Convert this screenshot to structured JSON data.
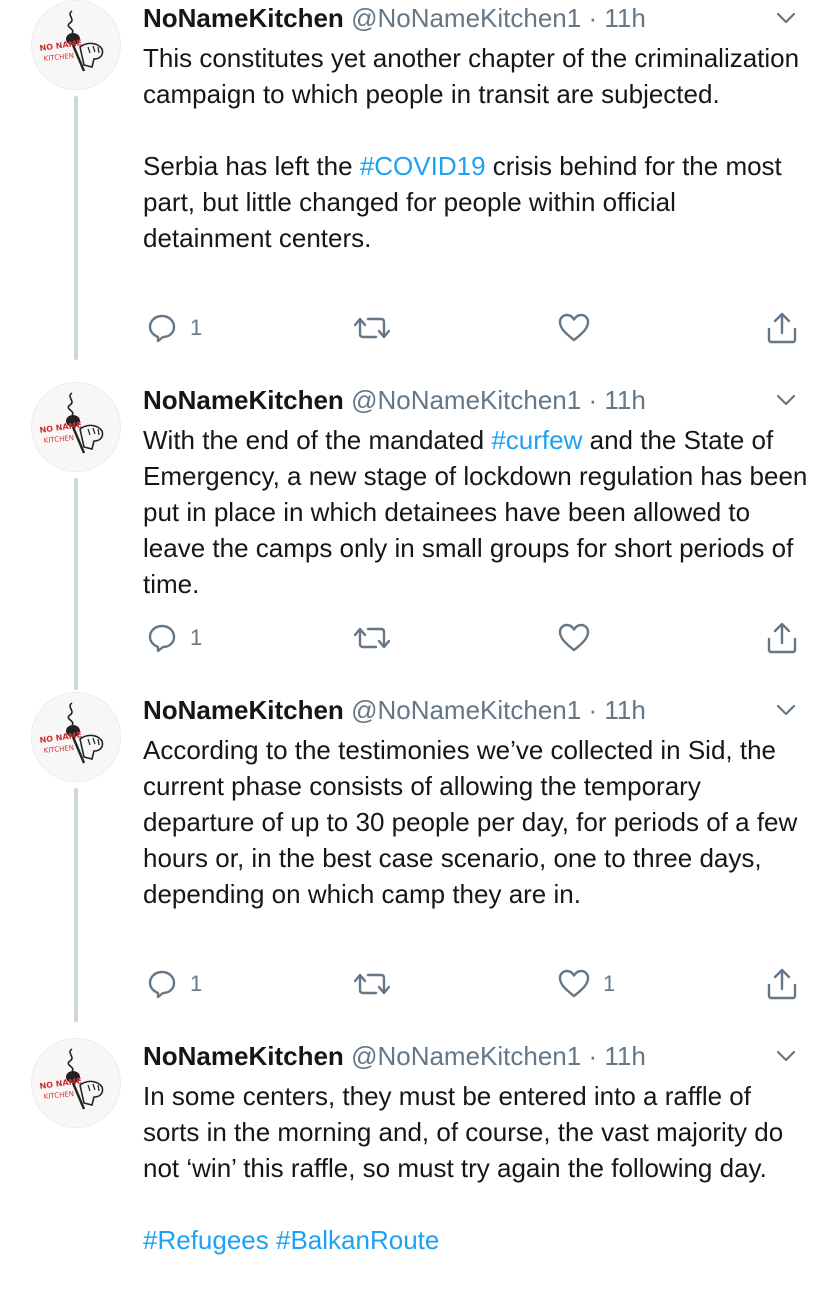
{
  "tweets": [
    {
      "name": "NoNameKitchen",
      "handle": "@NoNameKitchen1",
      "separator": "·",
      "time": "11h",
      "paragraphs": [
        [
          {
            "text": "This constitutes yet another chapter of the criminalization campaign to which people in transit are subjected."
          }
        ],
        [
          {
            "text": "Serbia has left the "
          },
          {
            "text": "#COVID19",
            "hashtag": true
          },
          {
            "text": " crisis behind for the most part, but little changed for people within official detainment centers."
          }
        ]
      ],
      "reply_count": "1",
      "like_count": ""
    },
    {
      "name": "NoNameKitchen",
      "handle": "@NoNameKitchen1",
      "separator": "·",
      "time": "11h",
      "paragraphs": [
        [
          {
            "text": "With the end of the mandated "
          },
          {
            "text": "#curfew",
            "hashtag": true
          },
          {
            "text": " and the State of Emergency, a new stage of lockdown regulation has been put in place in which detainees have been allowed to leave the camps only in small groups for short periods of time."
          }
        ]
      ],
      "reply_count": "1",
      "like_count": ""
    },
    {
      "name": "NoNameKitchen",
      "handle": "@NoNameKitchen1",
      "separator": "·",
      "time": "11h",
      "paragraphs": [
        [
          {
            "text": "According to the testimonies we’ve collected in Sid, the current phase consists of allowing the temporary departure of up to 30 people per day, for periods of a few hours or, in the best case scenario, one to three days, depending on which camp they are in."
          }
        ]
      ],
      "reply_count": "1",
      "like_count": "1"
    },
    {
      "name": "NoNameKitchen",
      "handle": "@NoNameKitchen1",
      "separator": "·",
      "time": "11h",
      "paragraphs": [
        [
          {
            "text": "In some centers, they must be entered into a raffle of sorts in the morning and, of course, the vast majority do not ‘win’ this raffle, so must try again the following day."
          }
        ],
        [
          {
            "text": "#Refugees",
            "hashtag": true
          },
          {
            "text": " "
          },
          {
            "text": "#BalkanRoute",
            "hashtag": true
          }
        ]
      ]
    }
  ],
  "avatar_logo": {
    "name": "NoNameKitchen logo",
    "text_line1": "NO NAME",
    "text_line2": "KITCHEN"
  },
  "icons": {
    "reply": "reply-icon",
    "retweet": "retweet-icon",
    "like": "like-icon",
    "share": "share-icon",
    "menu": "chevron-down-icon"
  },
  "colors": {
    "text": "#14171a",
    "secondary": "#657786",
    "hashtag": "#1da1f2",
    "thread_line": "#ccd6dd",
    "logo_red": "#d0312d"
  }
}
